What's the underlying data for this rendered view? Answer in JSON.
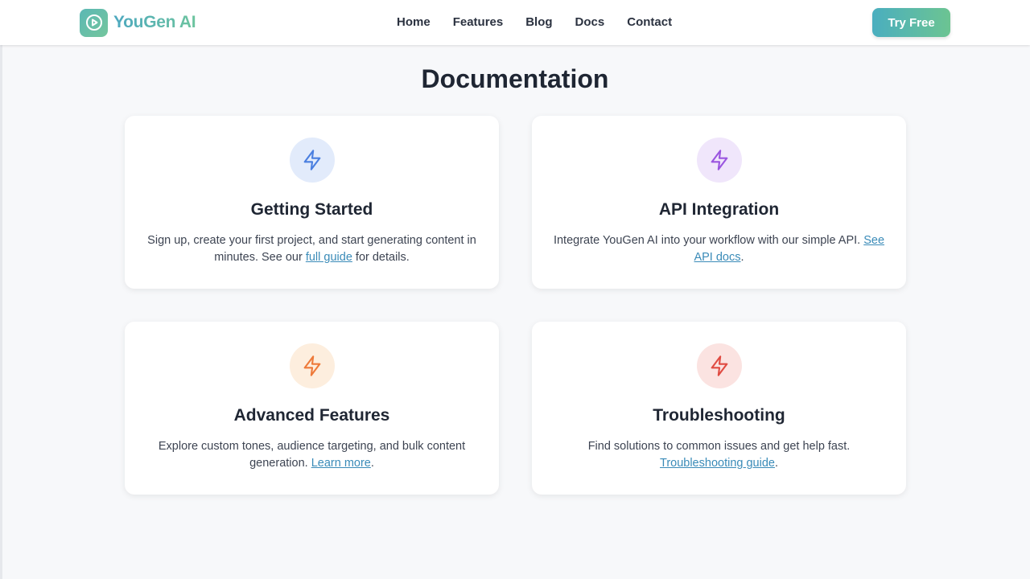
{
  "brand": {
    "name": "YouGen AI",
    "logo_icon": "play-circle-icon"
  },
  "nav": {
    "items": [
      "Home",
      "Features",
      "Blog",
      "Docs",
      "Contact"
    ]
  },
  "header": {
    "cta_label": "Try Free"
  },
  "page": {
    "title": "Documentation"
  },
  "cards": [
    {
      "icon": "lightning-icon",
      "icon_color": "#4a7fe0",
      "icon_bg": "#e2ebfb",
      "title": "Getting Started",
      "text_before": "Sign up, create your first project, and start generating content in minutes. See our ",
      "link": "full guide",
      "text_after": " for details."
    },
    {
      "icon": "lightning-icon",
      "icon_color": "#9a55e0",
      "icon_bg": "#f0e6fb",
      "title": "API Integration",
      "text_before": "Integrate YouGen AI into your workflow with our simple API. ",
      "link": "See API docs",
      "text_after": "."
    },
    {
      "icon": "lightning-icon",
      "icon_color": "#ee7a3a",
      "icon_bg": "#fdeede",
      "title": "Advanced Features",
      "text_before": "Explore custom tones, audience targeting, and bulk content generation. ",
      "link": "Learn more",
      "text_after": "."
    },
    {
      "icon": "lightning-icon",
      "icon_color": "#e04b42",
      "icon_bg": "#fbe3e1",
      "title": "Troubleshooting",
      "text_before": "Find solutions to common issues and get help fast. ",
      "link": "Troubleshooting guide",
      "text_after": "."
    }
  ]
}
